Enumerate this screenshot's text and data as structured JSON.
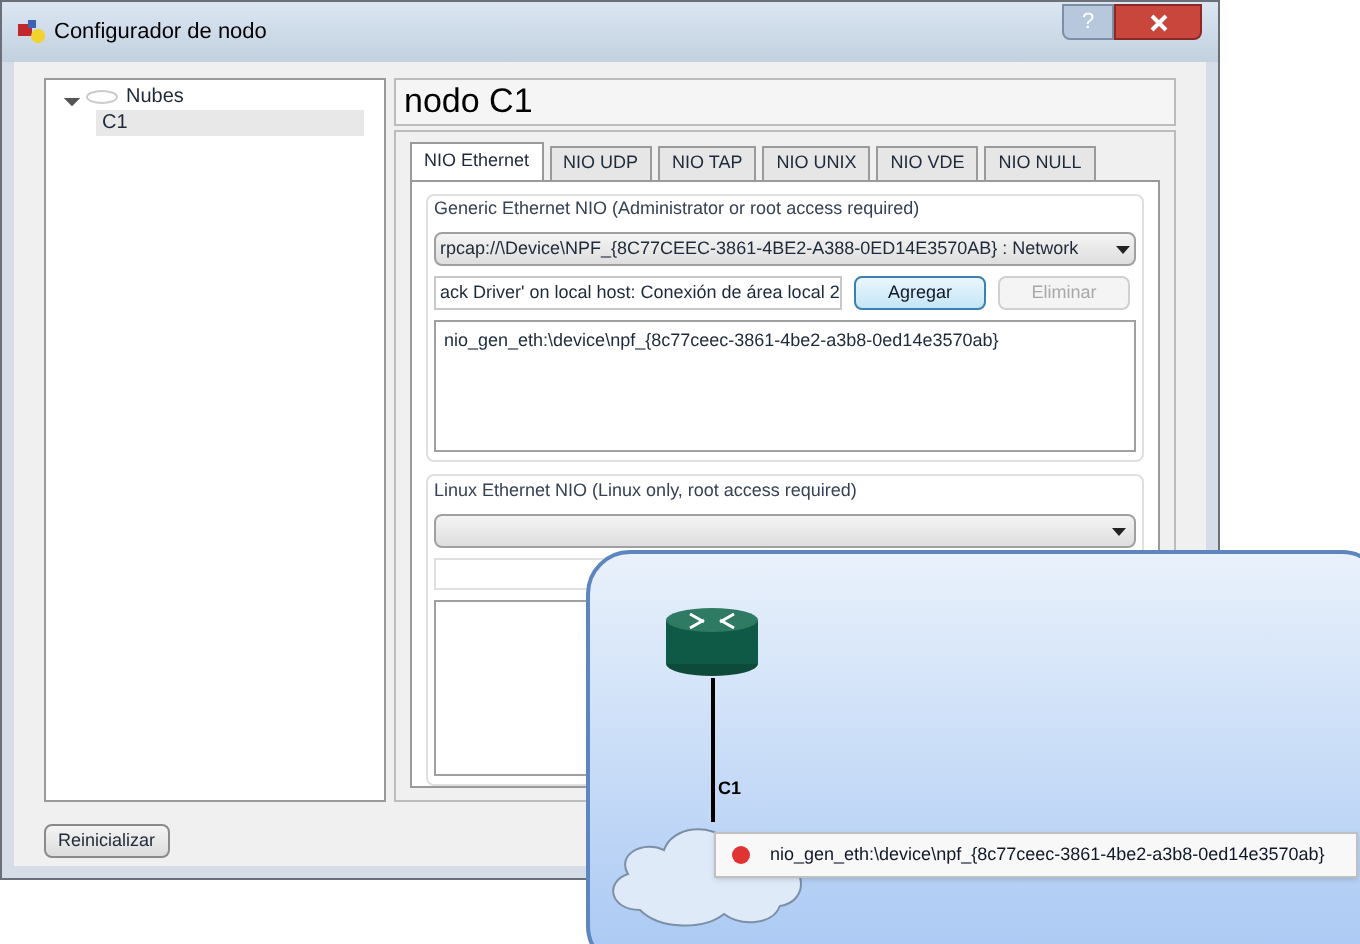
{
  "window": {
    "title": "Configurador de nodo",
    "help": "?"
  },
  "tree": [
    {
      "label": "Nubes",
      "expanded": true,
      "children": [
        {
          "label": "C1",
          "selected": true
        }
      ]
    }
  ],
  "header": "nodo C1",
  "tabs": [
    {
      "label": "NIO Ethernet",
      "selected": true
    },
    {
      "label": "NIO UDP",
      "selected": false
    },
    {
      "label": "NIO TAP",
      "selected": false
    },
    {
      "label": "NIO UNIX",
      "selected": false
    },
    {
      "label": "NIO VDE",
      "selected": false
    },
    {
      "label": "NIO NULL",
      "selected": false
    }
  ],
  "generic": {
    "title": "Generic Ethernet NIO (Administrator or root access required)",
    "combo": "rpcap://\\Device\\NPF_{8C77CEEC-3861-4BE2-A388-0ED14E3570AB} : Network",
    "field": "ack Driver' on local host: Conexión de área local 2",
    "buttons": [
      {
        "label": "Agregar",
        "disabled": false
      },
      {
        "label": "Eliminar",
        "disabled": true
      }
    ],
    "list": [
      "nio_gen_eth:\\device\\npf_{8c77ceec-3861-4be2-a3b8-0ed14e3570ab}"
    ]
  },
  "linux": {
    "title": "Linux Ethernet NIO (Linux only, root access required)"
  },
  "reset_button": "Reinicializar",
  "callout": {
    "link_label": "C1",
    "tooltip": "nio_gen_eth:\\device\\npf_{8c77ceec-3861-4be2-a3b8-0ed14e3570ab}"
  }
}
